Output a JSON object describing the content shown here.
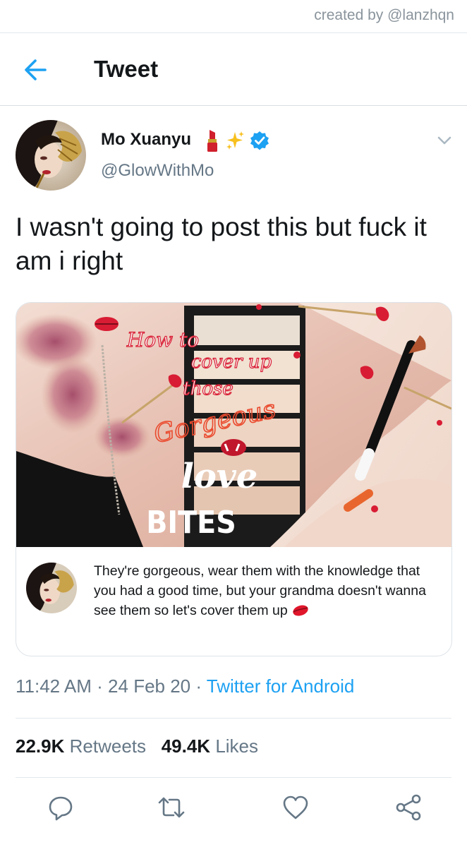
{
  "watermark": "created by @lanzhqn",
  "header": {
    "title": "Tweet",
    "back_icon": "arrow-left-icon"
  },
  "tweet": {
    "author_name": "Mo Xuanyu",
    "author_emoji": [
      "lipstick",
      "sparkles"
    ],
    "verified": true,
    "handle": "@GlowWithMo",
    "text": "I wasn't going to post this but fuck it am i right",
    "time": "11:42 AM",
    "date": "24 Feb 20",
    "source": "Twitter for Android",
    "retweets_count": "22.9K",
    "retweets_label": "Retweets",
    "likes_count": "49.4K",
    "likes_label": "Likes"
  },
  "card": {
    "image_text": [
      "How to",
      "cover up",
      "those",
      "Gorgeous",
      "love",
      "BITES"
    ],
    "description": "They're gorgeous, wear them with the knowledge that you had a good time, but your grandma doesn't wanna see them so let's cover them up",
    "description_emoji": "kiss-mark"
  },
  "actions": [
    "reply-icon",
    "retweet-icon",
    "like-icon",
    "share-icon"
  ],
  "colors": {
    "accent": "#1da1f2",
    "secondary_text": "#657786",
    "divider": "#e1e8ed"
  }
}
